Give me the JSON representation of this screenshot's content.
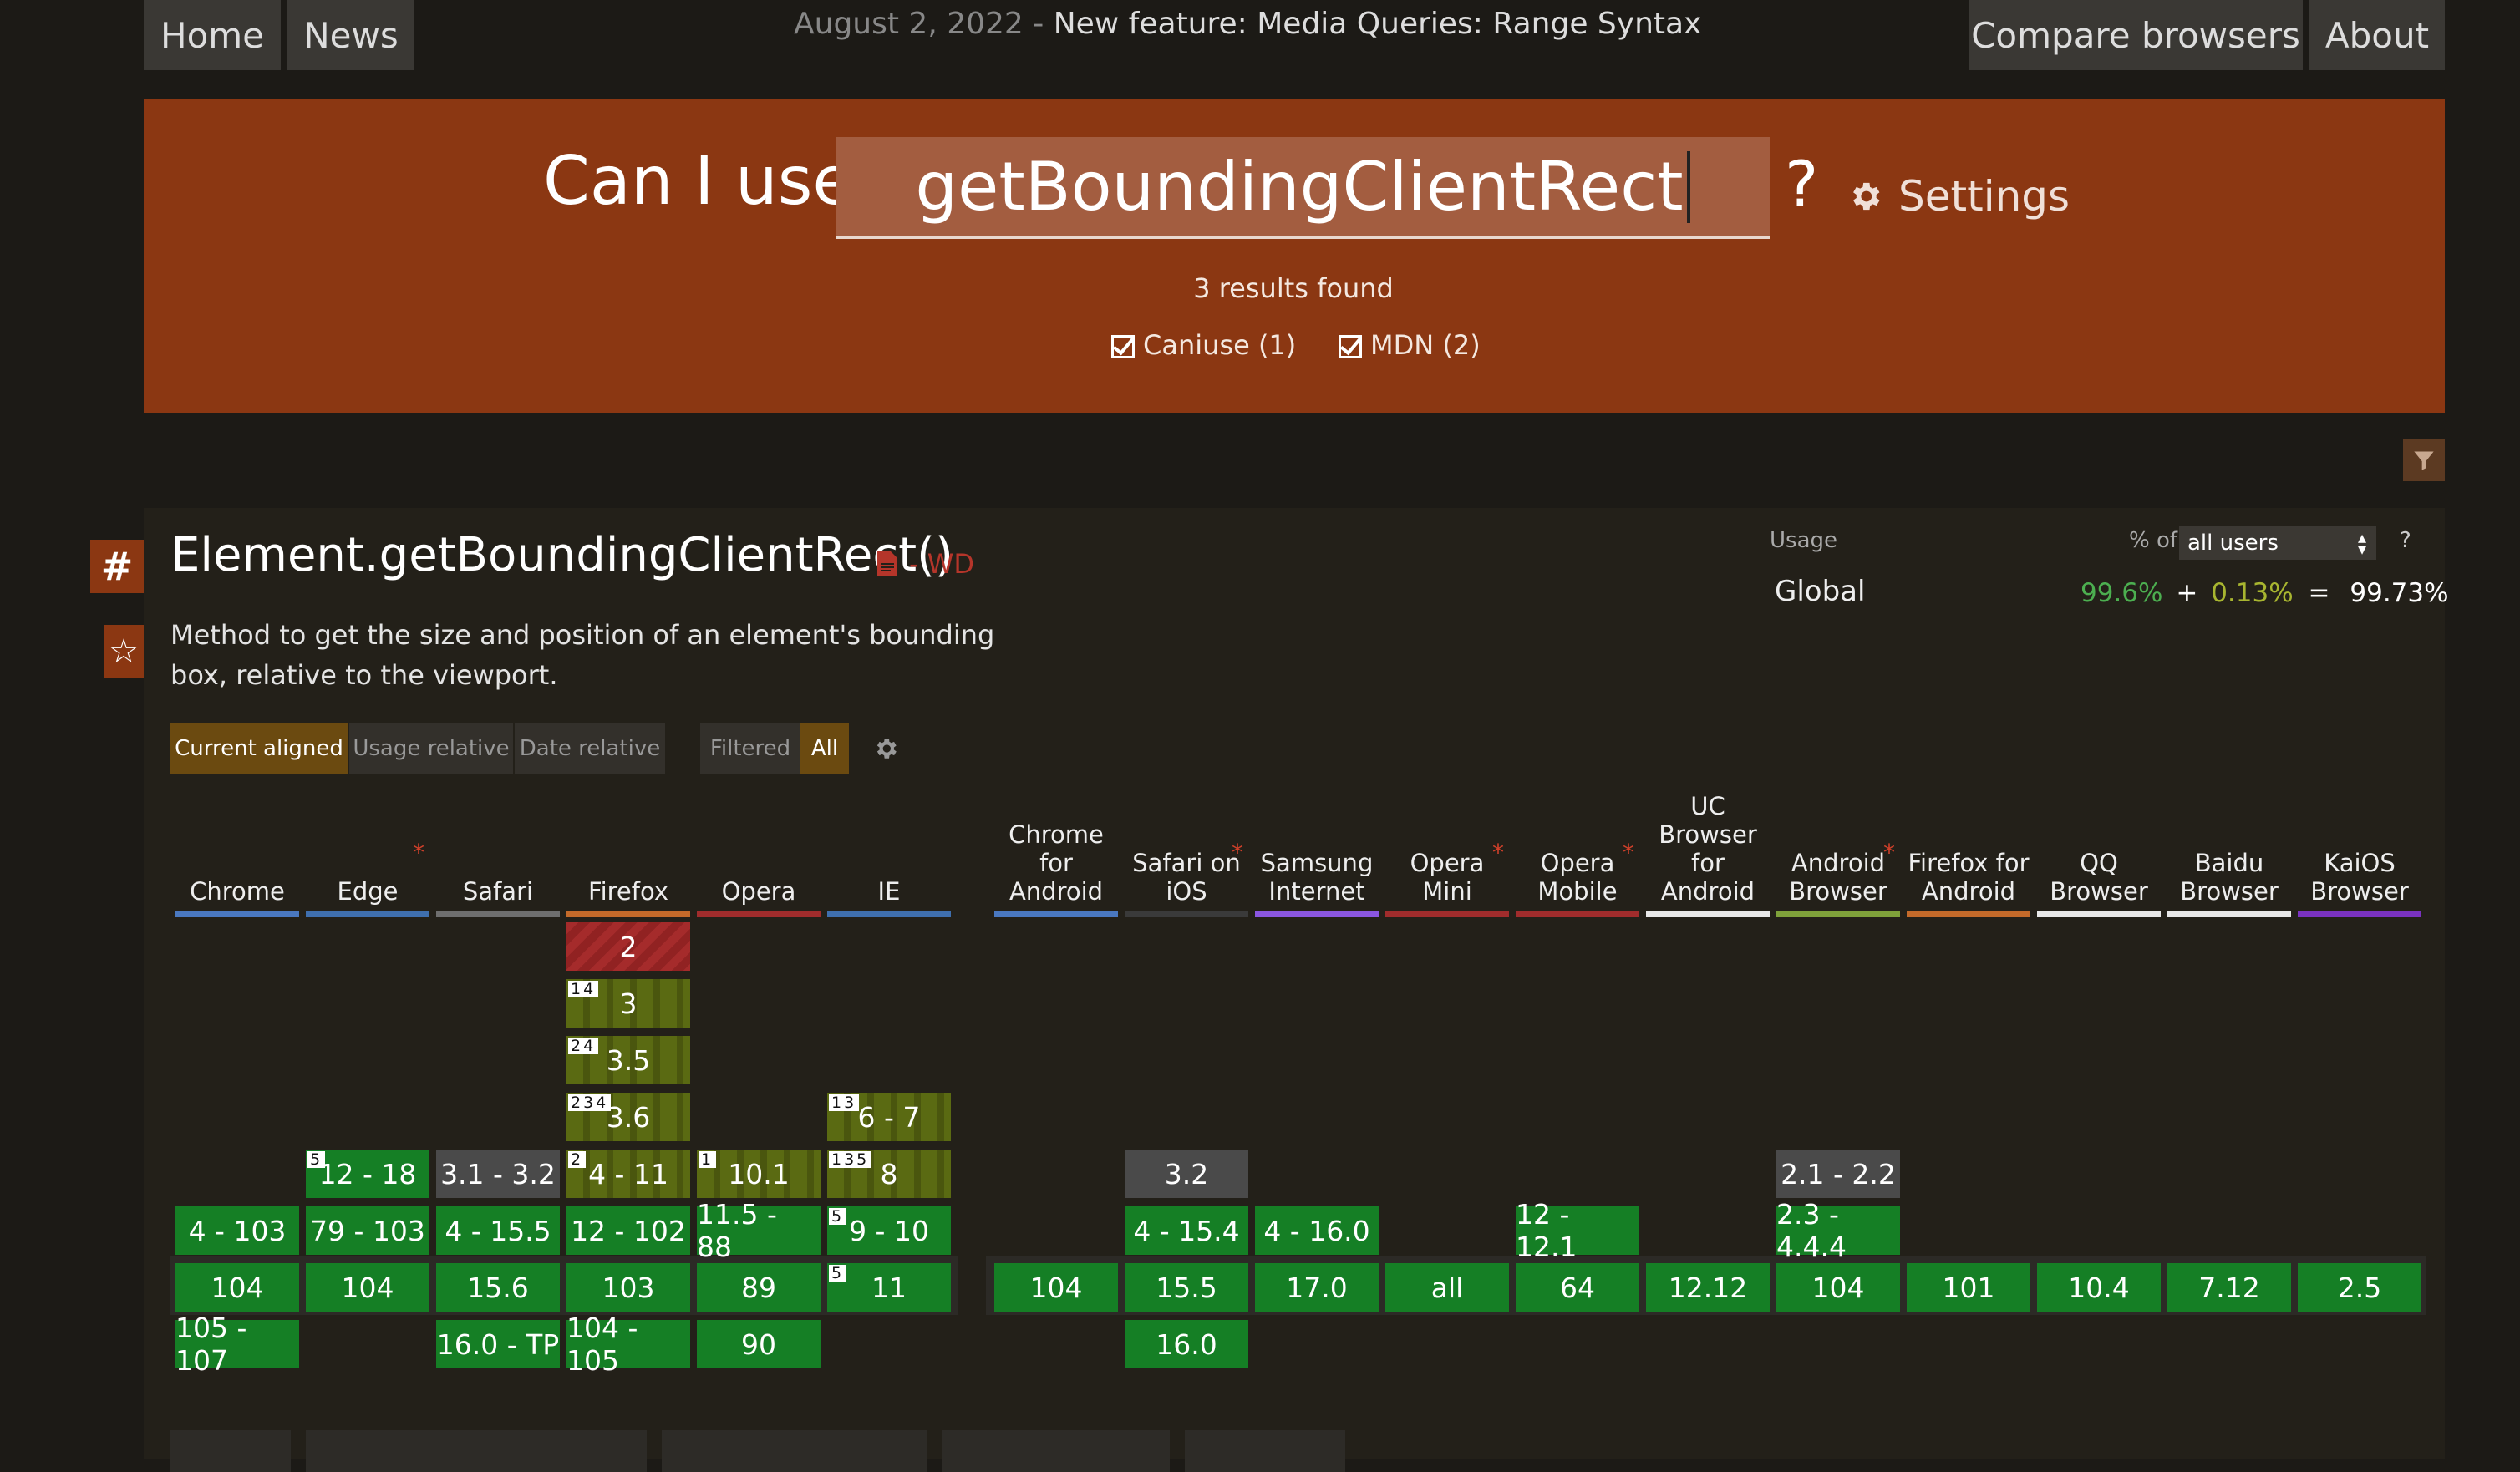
{
  "nav": {
    "home": "Home",
    "news": "News",
    "compare": "Compare browsers",
    "about": "About"
  },
  "news": {
    "date": "August 2, 2022 - ",
    "title": "New feature: Media Queries: Range Syntax"
  },
  "search": {
    "prefix": "Can I use",
    "value": "getBoundingClientRect",
    "question": "?",
    "settings": "Settings",
    "results": "3 results found",
    "filters": [
      {
        "label": "Caniuse (1)",
        "checked": true
      },
      {
        "label": "MDN (2)",
        "checked": true
      }
    ]
  },
  "feature": {
    "hash": "#",
    "star": "☆",
    "title": "Element.getBoundingClientRect()",
    "status": "- WD",
    "description": [
      "Method to get the size and position of an element's bounding",
      "box, relative to the viewport."
    ]
  },
  "usage": {
    "label": "Usage",
    "pct_of": "% of",
    "scope": "all users",
    "help": "?",
    "region": "Global",
    "full": "99.6%",
    "plus": "+",
    "partial": "0.13%",
    "eq": "=",
    "total": "99.73%"
  },
  "view": {
    "current": "Current aligned",
    "usage": "Usage relative",
    "date": "Date relative",
    "filtered": "Filtered",
    "all": "All"
  },
  "browsers": [
    {
      "name": "Chrome",
      "bar": "#4a78c0"
    },
    {
      "name": "Edge",
      "bar": "#3f6fae",
      "star": true
    },
    {
      "name": "Safari",
      "bar": "#6e6e6e"
    },
    {
      "name": "Firefox",
      "bar": "#c46a2a"
    },
    {
      "name": "Opera",
      "bar": "#a02c2c"
    },
    {
      "name": "IE",
      "bar": "#3f6fae"
    },
    {
      "name": "Chrome for Android",
      "bar": "#4a78c0"
    },
    {
      "name": "Safari on iOS",
      "bar": "#3a3a3a",
      "star": true
    },
    {
      "name": "Samsung Internet",
      "bar": "#8a56e0"
    },
    {
      "name": "Opera Mini",
      "bar": "#a02c2c",
      "star": true
    },
    {
      "name": "Opera Mobile",
      "bar": "#a02c2c",
      "star": true
    },
    {
      "name": "UC Browser for Android",
      "bar": "#e8e8e8"
    },
    {
      "name": "Android Browser",
      "bar": "#7fa13a",
      "star": true
    },
    {
      "name": "Firefox for Android",
      "bar": "#c46a2a"
    },
    {
      "name": "QQ Browser",
      "bar": "#e8e8e8"
    },
    {
      "name": "Baidu Browser",
      "bar": "#e8e8e8"
    },
    {
      "name": "KaiOS Browser",
      "bar": "#7a32c0"
    }
  ],
  "support": [
    {
      "b": 0,
      "row": 5,
      "v": "4 - 103",
      "s": "y"
    },
    {
      "b": 0,
      "row": 6,
      "v": "104",
      "s": "y"
    },
    {
      "b": 0,
      "row": 7,
      "v": "105 - 107",
      "s": "y"
    },
    {
      "b": 1,
      "row": 4,
      "v": "12 - 18",
      "s": "y",
      "n": "5"
    },
    {
      "b": 1,
      "row": 5,
      "v": "79 - 103",
      "s": "y"
    },
    {
      "b": 1,
      "row": 6,
      "v": "104",
      "s": "y"
    },
    {
      "b": 2,
      "row": 4,
      "v": "3.1 - 3.2",
      "s": "g"
    },
    {
      "b": 2,
      "row": 5,
      "v": "4 - 15.5",
      "s": "y"
    },
    {
      "b": 2,
      "row": 6,
      "v": "15.6",
      "s": "y"
    },
    {
      "b": 2,
      "row": 7,
      "v": "16.0 - TP",
      "s": "y"
    },
    {
      "b": 3,
      "row": 0,
      "v": "2",
      "s": "r"
    },
    {
      "b": 3,
      "row": 1,
      "v": "3",
      "s": "p",
      "n": "1 4"
    },
    {
      "b": 3,
      "row": 2,
      "v": "3.5",
      "s": "p",
      "n": "2 4"
    },
    {
      "b": 3,
      "row": 3,
      "v": "3.6",
      "s": "p",
      "n": "2 3 4"
    },
    {
      "b": 3,
      "row": 4,
      "v": "4 - 11",
      "s": "p",
      "n": "2"
    },
    {
      "b": 3,
      "row": 5,
      "v": "12 - 102",
      "s": "y"
    },
    {
      "b": 3,
      "row": 6,
      "v": "103",
      "s": "y"
    },
    {
      "b": 3,
      "row": 7,
      "v": "104 - 105",
      "s": "y"
    },
    {
      "b": 4,
      "row": 4,
      "v": "10.1",
      "s": "p",
      "n": "1"
    },
    {
      "b": 4,
      "row": 5,
      "v": "11.5 - 88",
      "s": "y"
    },
    {
      "b": 4,
      "row": 6,
      "v": "89",
      "s": "y"
    },
    {
      "b": 4,
      "row": 7,
      "v": "90",
      "s": "y"
    },
    {
      "b": 5,
      "row": 3,
      "v": "6 - 7",
      "s": "p",
      "n": "1 3"
    },
    {
      "b": 5,
      "row": 4,
      "v": "8",
      "s": "p",
      "n": "1 3 5"
    },
    {
      "b": 5,
      "row": 5,
      "v": "9 - 10",
      "s": "y",
      "n": "5"
    },
    {
      "b": 5,
      "row": 6,
      "v": "11",
      "s": "y",
      "n": "5"
    },
    {
      "b": 6,
      "row": 6,
      "v": "104",
      "s": "y"
    },
    {
      "b": 7,
      "row": 4,
      "v": "3.2",
      "s": "g"
    },
    {
      "b": 7,
      "row": 5,
      "v": "4 - 15.4",
      "s": "y"
    },
    {
      "b": 7,
      "row": 6,
      "v": "15.5",
      "s": "y"
    },
    {
      "b": 7,
      "row": 7,
      "v": "16.0",
      "s": "y"
    },
    {
      "b": 8,
      "row": 5,
      "v": "4 - 16.0",
      "s": "y"
    },
    {
      "b": 8,
      "row": 6,
      "v": "17.0",
      "s": "y"
    },
    {
      "b": 9,
      "row": 6,
      "v": "all",
      "s": "y"
    },
    {
      "b": 10,
      "row": 5,
      "v": "12 - 12.1",
      "s": "y"
    },
    {
      "b": 10,
      "row": 6,
      "v": "64",
      "s": "y"
    },
    {
      "b": 11,
      "row": 6,
      "v": "12.12",
      "s": "y"
    },
    {
      "b": 12,
      "row": 4,
      "v": "2.1 - 2.2",
      "s": "g"
    },
    {
      "b": 12,
      "row": 5,
      "v": "2.3 - 4.4.4",
      "s": "y"
    },
    {
      "b": 12,
      "row": 6,
      "v": "104",
      "s": "y"
    },
    {
      "b": 13,
      "row": 6,
      "v": "101",
      "s": "y"
    },
    {
      "b": 14,
      "row": 6,
      "v": "10.4",
      "s": "y"
    },
    {
      "b": 15,
      "row": 6,
      "v": "7.12",
      "s": "y"
    },
    {
      "b": 16,
      "row": 6,
      "v": "2.5",
      "s": "y"
    }
  ]
}
